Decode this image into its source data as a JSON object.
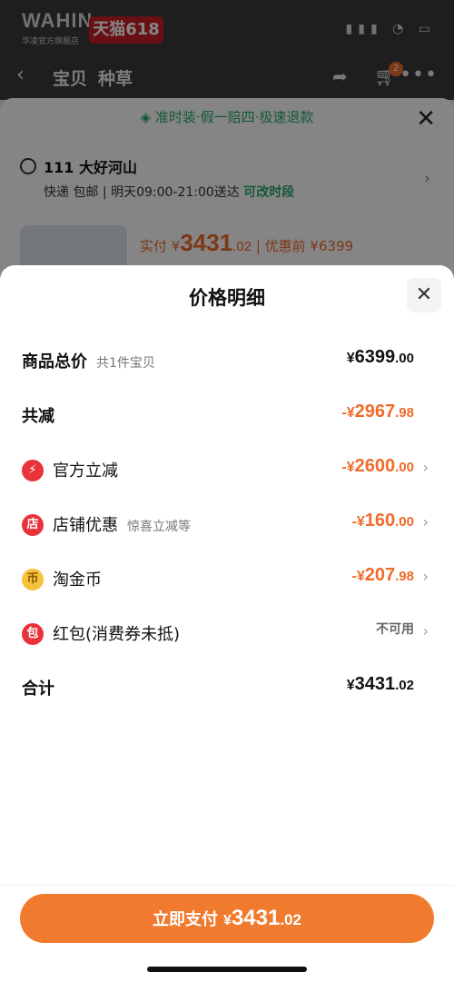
{
  "status_bar": {
    "brand": "WAHIN",
    "brand_sub": "华凌官方旗舰店",
    "promo_badge": "天猫618"
  },
  "navbar": {
    "tabs": [
      "宝贝",
      "种草"
    ],
    "cart_count": "2"
  },
  "behind": {
    "promise": "准时装·假一赔四·极速退款",
    "address": "111 大好河山",
    "shipping": "快递 包邮 | 明天09:00-21:00送达",
    "shipping_change": "可改时段",
    "paid_label": "实付",
    "paid_symbol": "¥",
    "paid_int": "3431",
    "paid_dec": ".02",
    "before_label": "| 优惠前 ¥6399"
  },
  "sheet": {
    "title": "价格明细",
    "rows": [
      {
        "label": "商品总价",
        "note": "共1件宝贝",
        "sym": "¥",
        "int": "6399",
        "dec": ".00"
      },
      {
        "label": "共减",
        "sym": "-¥",
        "int": "2967",
        "dec": ".98"
      },
      {
        "label": "官方立减",
        "sym": "-¥",
        "int": "2600",
        "dec": ".00"
      },
      {
        "label": "店铺优惠",
        "note": "惊喜立减等",
        "sym": "-¥",
        "int": "160",
        "dec": ".00"
      },
      {
        "label": "淘金币",
        "sym": "-¥",
        "int": "207",
        "dec": ".98"
      },
      {
        "label": "红包(消费券未抵)",
        "status": "不可用"
      },
      {
        "label": "合计",
        "sym": "¥",
        "int": "3431",
        "dec": ".02"
      }
    ],
    "icons": {
      "official": "⚡",
      "shop": "店",
      "coin": "币",
      "redpack": "包"
    },
    "colors": {
      "accent": "#f06a2a",
      "red_icon": "#e8333a",
      "gold_icon": "#f4c23c",
      "pay_button": "#f07a2e"
    }
  },
  "pay_button": {
    "label": "立即支付",
    "sym": "¥",
    "int": "3431",
    "dec": ".02"
  }
}
